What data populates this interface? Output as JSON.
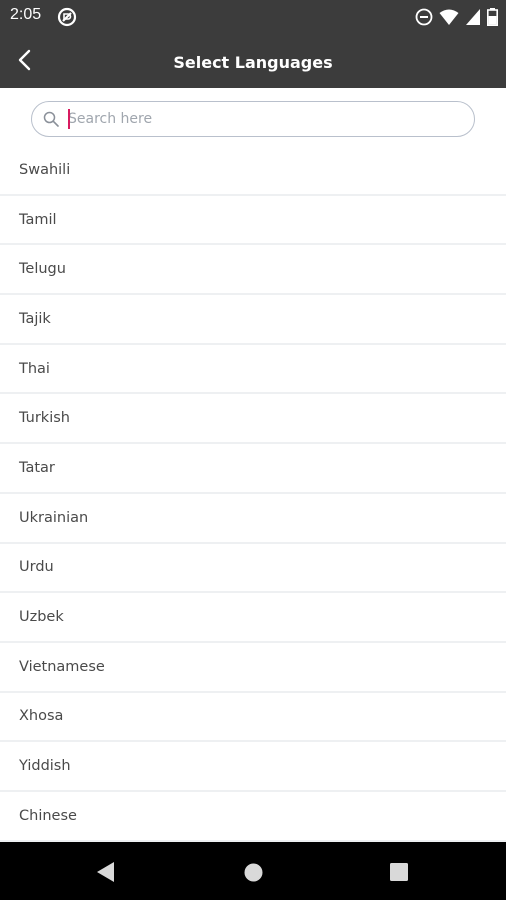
{
  "status_bar": {
    "time": "2:05",
    "icons": [
      "do-not-disturb-icon",
      "wifi-icon",
      "cellular-signal-icon",
      "battery-icon"
    ]
  },
  "app_bar": {
    "title": "Select Languages",
    "back_icon": "chevron-left-icon"
  },
  "search": {
    "placeholder": "Search here",
    "value": ""
  },
  "languages": [
    "Swahili",
    "Tamil",
    "Telugu",
    "Tajik",
    "Thai",
    "Turkish",
    "Tatar",
    "Ukrainian",
    "Urdu",
    "Uzbek",
    "Vietnamese",
    "Xhosa",
    "Yiddish",
    "Chinese"
  ],
  "nav_bar": {
    "buttons": [
      "back-triangle-icon",
      "home-circle-icon",
      "recents-square-icon"
    ]
  },
  "colors": {
    "app_bar": "#3c3c3c",
    "caret": "#d81b60",
    "divider": "#eef0f2",
    "text": "#4a4a4a"
  }
}
